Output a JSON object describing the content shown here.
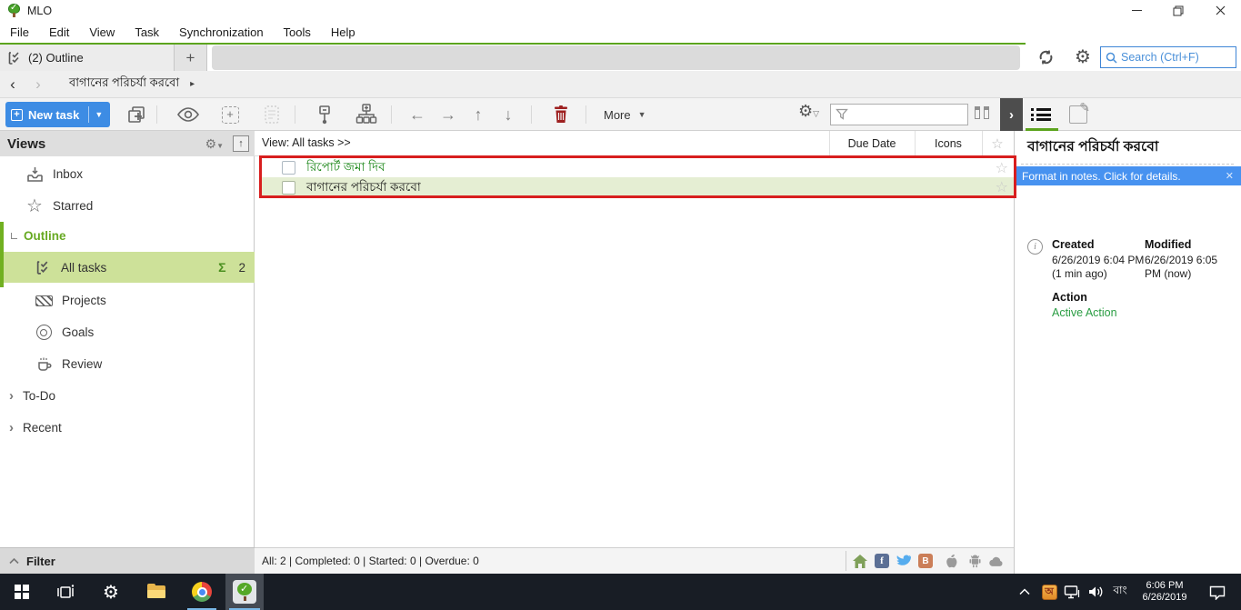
{
  "window": {
    "title": "MLO"
  },
  "menu": [
    "File",
    "Edit",
    "View",
    "Task",
    "Synchronization",
    "Tools",
    "Help"
  ],
  "tabs": {
    "active_label": "(2) Outline",
    "add_label": "+"
  },
  "topbar": {
    "search_placeholder": "Search (Ctrl+F)"
  },
  "breadcrumb": {
    "back": "‹",
    "forward": "›",
    "current": "বাগানের পরিচর্যা করবো",
    "caret": "▸"
  },
  "toolbar": {
    "new_task_label": "New task",
    "more_label": "More",
    "next_pane": "›"
  },
  "sidebar": {
    "title": "Views",
    "filter_label": "Filter",
    "items": {
      "inbox": "Inbox",
      "starred": "Starred",
      "outline": "Outline",
      "all_tasks": "All tasks",
      "all_tasks_sigma": "Σ",
      "all_tasks_count": "2",
      "projects": "Projects",
      "goals": "Goals",
      "review": "Review",
      "todo": "To-Do",
      "recent": "Recent"
    }
  },
  "list": {
    "view_label": "View: All tasks >>",
    "col_due_date": "Due Date",
    "col_icons": "Icons",
    "tasks": [
      {
        "title": "রিপোর্ট জমা দিব"
      },
      {
        "title": "বাগানের পরিচর্যা করবো"
      }
    ],
    "status": "All: 2 | Completed: 0 | Started: 0 | Overdue: 0"
  },
  "details": {
    "title": "বাগানের পরিচর্যা করবো",
    "notice": "Format in notes. Click  for details.",
    "notice_close": "✕",
    "info_glyph": "i",
    "created_label": "Created",
    "created_value": "6/26/2019 6:04 PM (1 min ago)",
    "modified_label": "Modified",
    "modified_value": "6/26/2019 6:05 PM (now)",
    "action_label": "Action",
    "action_value": "Active Action"
  },
  "taskbar": {
    "ime_badge": "অ",
    "language": "বাং",
    "time": "6:06 PM",
    "date": "6/26/2019"
  },
  "colors": {
    "accent_green": "#5ca41e",
    "sidebar_selection": "#cde199",
    "row_selection": "#e5eed3",
    "task_green_text": "#12820f",
    "accent_blue": "#3d8ce4",
    "notice_blue": "#4792f0",
    "annotation_red": "#d81e1e"
  }
}
